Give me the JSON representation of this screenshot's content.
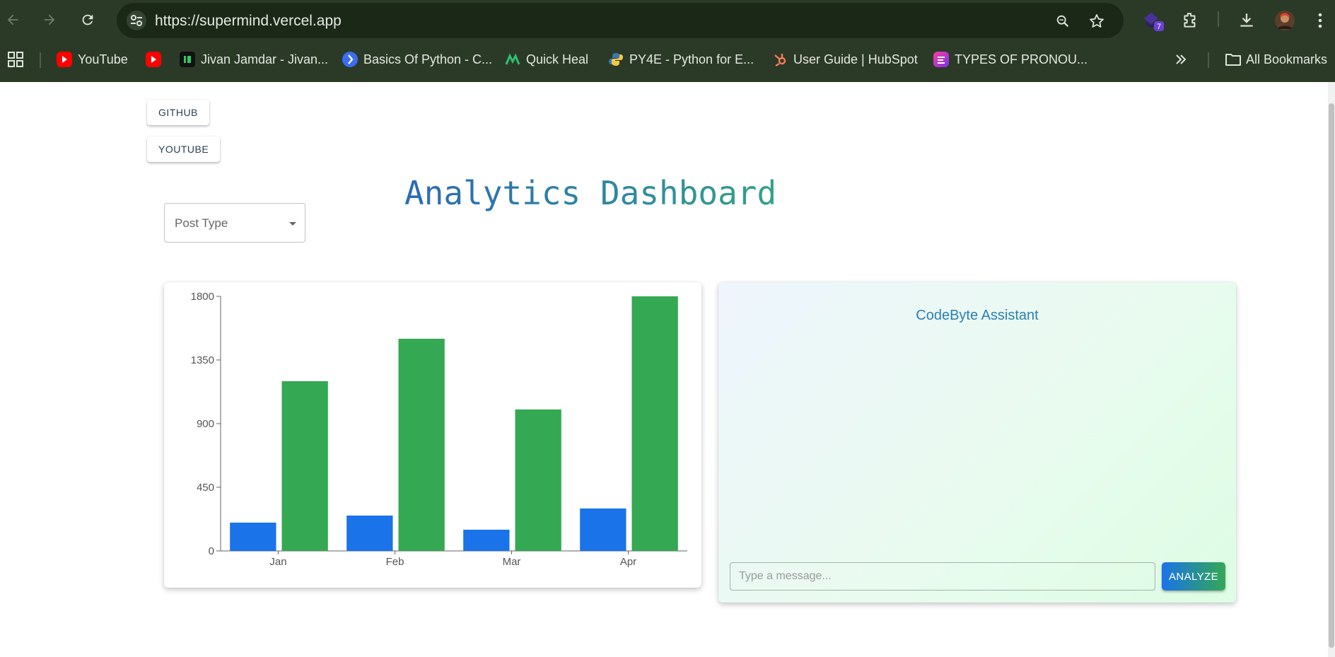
{
  "browser": {
    "url": "https://supermind.vercel.app",
    "extension_badge": "7",
    "bookmarks": [
      {
        "label": "YouTube",
        "color": "#ff0000"
      },
      {
        "label": "",
        "color": "#ff0000"
      },
      {
        "label": "Jivan Jamdar - Jivan...",
        "color": "#111111"
      },
      {
        "label": "Basics Of Python - C...",
        "color": "#3b6df0"
      },
      {
        "label": "Quick Heal",
        "color": "#2fbf71"
      },
      {
        "label": "PY4E - Python for E...",
        "color": "#f4c842"
      },
      {
        "label": "User Guide | HubSpot",
        "color": "#ff7a59"
      },
      {
        "label": "TYPES OF PRONOU...",
        "color": "#b030e0"
      }
    ],
    "all_bookmarks": "All Bookmarks"
  },
  "page": {
    "github_label": "GITHUB",
    "youtube_label": "YOUTUBE",
    "title": "Analytics Dashboard",
    "post_type_label": "Post Type"
  },
  "chart_data": {
    "type": "bar",
    "categories": [
      "Jan",
      "Feb",
      "Mar",
      "Apr"
    ],
    "series": [
      {
        "values": [
          200,
          250,
          150,
          300
        ],
        "color": "#1a73e8"
      },
      {
        "values": [
          1200,
          1500,
          1000,
          1800
        ],
        "color": "#34a853"
      }
    ],
    "yticks": [
      0,
      450,
      900,
      1350,
      1800
    ],
    "ylim": [
      0,
      1800
    ],
    "grid": false,
    "title": "",
    "xlabel": "",
    "ylabel": ""
  },
  "assistant": {
    "title": "CodeByte Assistant",
    "input_placeholder": "Type a message...",
    "send_label": "ANALYZE"
  }
}
